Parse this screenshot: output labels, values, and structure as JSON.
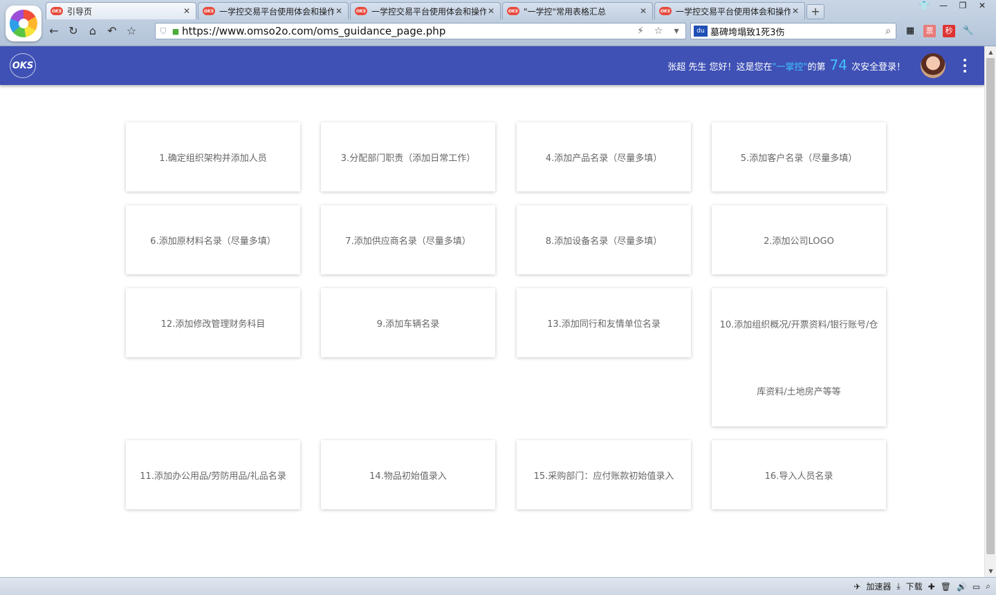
{
  "browser": {
    "tabs": [
      {
        "label": "引导页",
        "active": true
      },
      {
        "label": "一学控交易平台使用体会和操作",
        "active": false
      },
      {
        "label": "一学控交易平台使用体会和操作",
        "active": false
      },
      {
        "label": "\"一学控\"常用表格汇总",
        "active": false
      },
      {
        "label": "一学控交易平台使用体会和操作",
        "active": false
      }
    ],
    "url": "https://www.omso2o.com/oms_guidance_page.php",
    "search_text": "墓碑垮塌致1死3伤",
    "search_engine_icon": "baidu-icon",
    "favicon_text": "OKS",
    "red_button_label": "秒",
    "pink_button_label": "票"
  },
  "header": {
    "logo_text": "OKS",
    "greeting_prefix": "张超 先生 您好！这是您在",
    "brand": "\"一掌控\"",
    "greeting_mid": "的第",
    "login_count": "74",
    "greeting_suffix": "次安全登录！",
    "accent_color": "#3f51b5",
    "highlight_color": "#40c4ff"
  },
  "cards": [
    {
      "label": "1.确定组织架构并添加人员"
    },
    {
      "label": "3.分配部门职责（添加日常工作）"
    },
    {
      "label": "4.添加产品名录（尽量多填）"
    },
    {
      "label": "5.添加客户名录（尽量多填）"
    },
    {
      "label": "6.添加原材料名录（尽量多填）"
    },
    {
      "label": "7.添加供应商名录（尽量多填）"
    },
    {
      "label": "8.添加设备名录（尽量多填）"
    },
    {
      "label": "2.添加公司LOGO"
    },
    {
      "label": "12.添加修改管理财务科目"
    },
    {
      "label": "9.添加车辆名录"
    },
    {
      "label": "13.添加同行和友情单位名录"
    },
    {
      "label_line1": "10.添加组织概况/开票资料/银行账号/仓",
      "label_line2": "库资料/土地房产等等"
    },
    {
      "label": "11.添加办公用品/劳防用品/礼品名录"
    },
    {
      "label": "14.物品初始值录入"
    },
    {
      "label": "15.采购部门：应付账款初始值录入"
    },
    {
      "label": "16.导入人员名录"
    }
  ],
  "statusbar": {
    "accelerator": "加速器",
    "download": "下载"
  }
}
